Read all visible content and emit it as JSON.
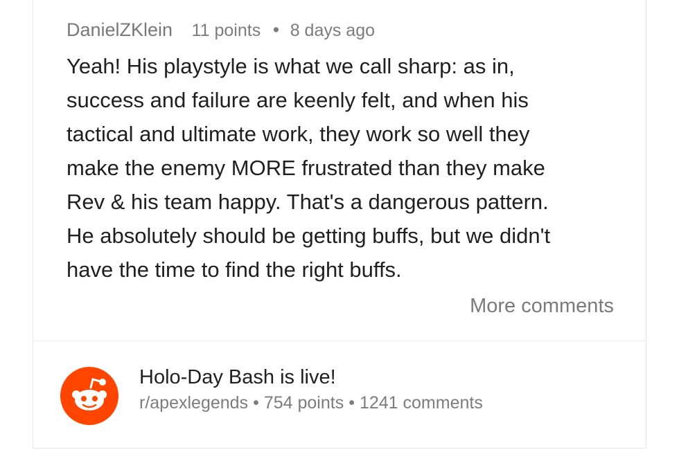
{
  "comment": {
    "author": "DanielZKlein",
    "points": "11 points",
    "separator": "•",
    "age": "8 days ago",
    "lines": [
      "Yeah! His playstyle is what we call sharp: as in,",
      "success and failure are keenly felt, and when his",
      "tactical and ultimate work, they work so well they",
      "make the enemy MORE frustrated than they make",
      "Rev & his team happy. That's a dangerous pattern.",
      "He absolutely should be getting buffs, but we didn't",
      "have the time to find the right buffs."
    ],
    "more_comments_label": "More comments"
  },
  "post": {
    "avatar_icon": "reddit-snoo-icon",
    "avatar_color": "#ff4500",
    "title": "Holo-Day Bash is live!",
    "subreddit": "r/apexlegends",
    "separator": "•",
    "points": "754 points",
    "comments": "1241 comments"
  }
}
